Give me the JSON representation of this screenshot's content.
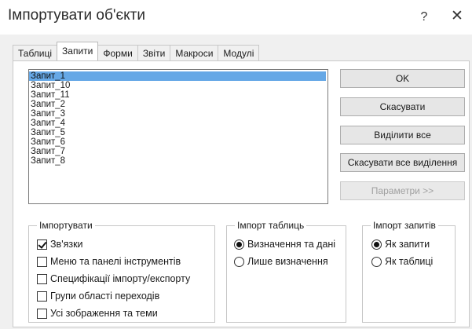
{
  "window": {
    "title": "Імпортувати об'єкти",
    "help_label": "?",
    "close_label": "✕"
  },
  "tabs": [
    {
      "label": "Таблиці",
      "active": false
    },
    {
      "label": "Запити",
      "active": true
    },
    {
      "label": "Форми",
      "active": false
    },
    {
      "label": "Звіти",
      "active": false
    },
    {
      "label": "Макроси",
      "active": false
    },
    {
      "label": "Модулі",
      "active": false
    }
  ],
  "queries": {
    "items": [
      "Запит_1",
      "Запит_10",
      "Запит_11",
      "Запит_2",
      "Запит_3",
      "Запит_4",
      "Запит_5",
      "Запит_6",
      "Запит_7",
      "Запит_8"
    ],
    "selected": "Запит_1"
  },
  "buttons": {
    "ok": "OK",
    "cancel": "Скасувати",
    "select_all": "Виділити все",
    "deselect_all": "Скасувати все виділення",
    "options": "Параметри >>"
  },
  "import_group": {
    "title": "Імпортувати",
    "options": [
      {
        "label": "Зв'язки",
        "checked": true
      },
      {
        "label": "Меню та панелі інструментів",
        "checked": false
      },
      {
        "label": "Специфікації імпорту/експорту",
        "checked": false
      },
      {
        "label": "Групи області переходів",
        "checked": false
      },
      {
        "label": "Усі зображення та теми",
        "checked": false
      }
    ]
  },
  "import_tables_group": {
    "title": "Імпорт таблиць",
    "options": [
      {
        "label": "Визначення та дані",
        "checked": true
      },
      {
        "label": "Лише визначення",
        "checked": false
      }
    ]
  },
  "import_queries_group": {
    "title": "Імпорт запитів",
    "options": [
      {
        "label": "Як запити",
        "checked": true
      },
      {
        "label": "Як таблиці",
        "checked": false
      }
    ]
  },
  "colors": {
    "selection": "#66a8e6",
    "dialog_bg": "#f0f0f0",
    "panel_bg": "#ffffff"
  }
}
